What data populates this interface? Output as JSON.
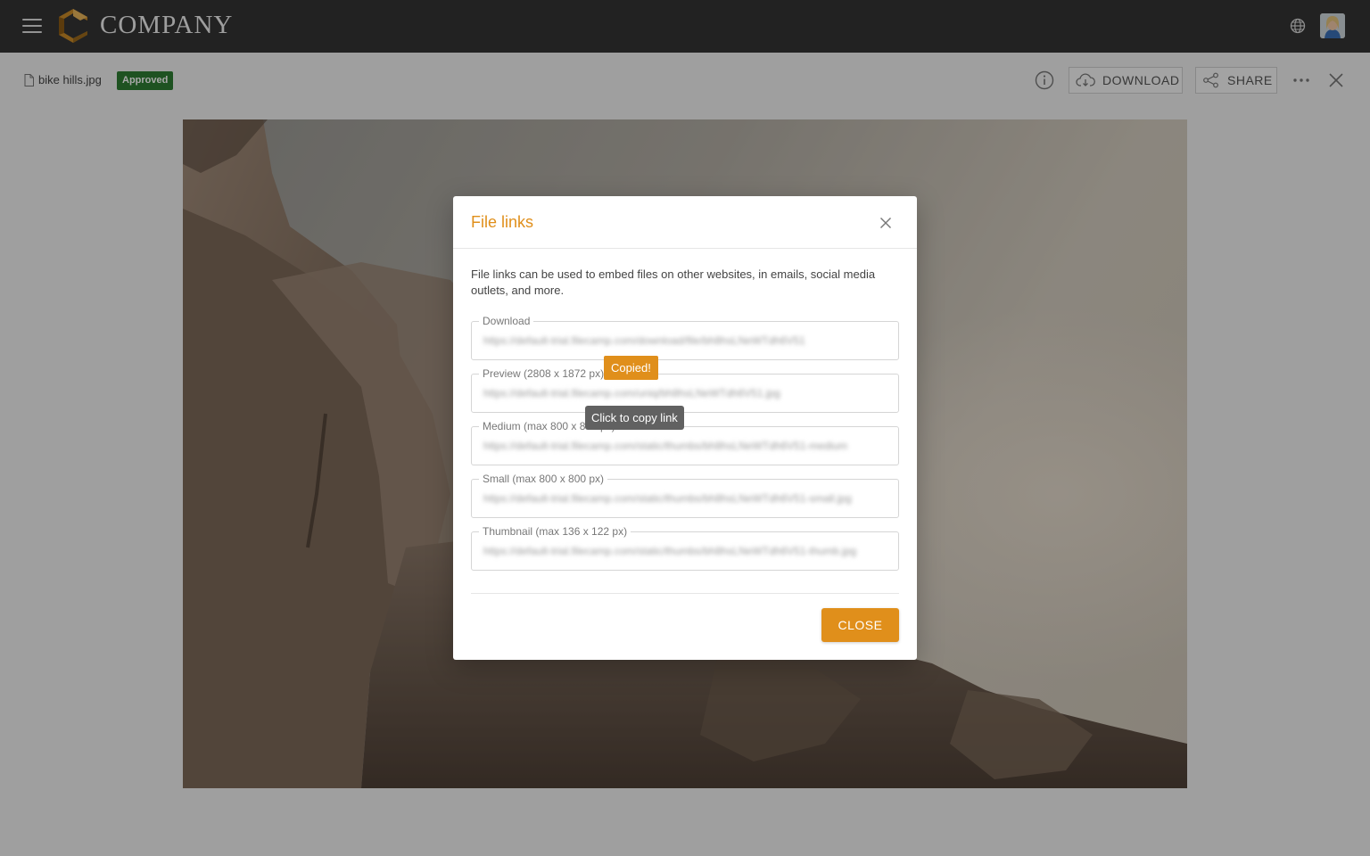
{
  "header": {
    "brand": "COMPANY",
    "menu_icon": "hamburger-icon",
    "globe_icon": "globe-icon"
  },
  "file": {
    "name": "bike hills.jpg",
    "status": "Approved"
  },
  "toolbar": {
    "download_label": "DOWNLOAD",
    "share_label": "SHARE"
  },
  "modal": {
    "title": "File links",
    "description": "File links can be used to embed files on other websites, in emails, social media outlets, and more.",
    "fields": [
      {
        "label": "Download",
        "value": "https://default-trial.filecamp.com/download/file/bh8hsLNeWTdh6V51"
      },
      {
        "label": "Preview (2808 x 1872 px)",
        "value": "https://default-trial.filecamp.com/uniq/bh8hsLNeWTdh6V51.jpg"
      },
      {
        "label": "Medium (max 800 x 800 px)",
        "value": "https://default-trial.filecamp.com/static/thumbs/bh8hsLNeWTdh6V51-medium"
      },
      {
        "label": "Small (max 800 x 800 px)",
        "value": "https://default-trial.filecamp.com/static/thumbs/bh8hsLNeWTdh6V51-small.jpg"
      },
      {
        "label": "Thumbnail (max 136 x 122 px)",
        "value": "https://default-trial.filecamp.com/static/thumbs/bh8hsLNeWTdh6V51-thumb.jpg"
      }
    ],
    "tooltip_copied": "Copied!",
    "tooltip_copy": "Click to copy link",
    "close_label": "CLOSE"
  },
  "colors": {
    "accent": "#e08f1b",
    "topbar": "#353535",
    "approved": "#2e7d32"
  }
}
